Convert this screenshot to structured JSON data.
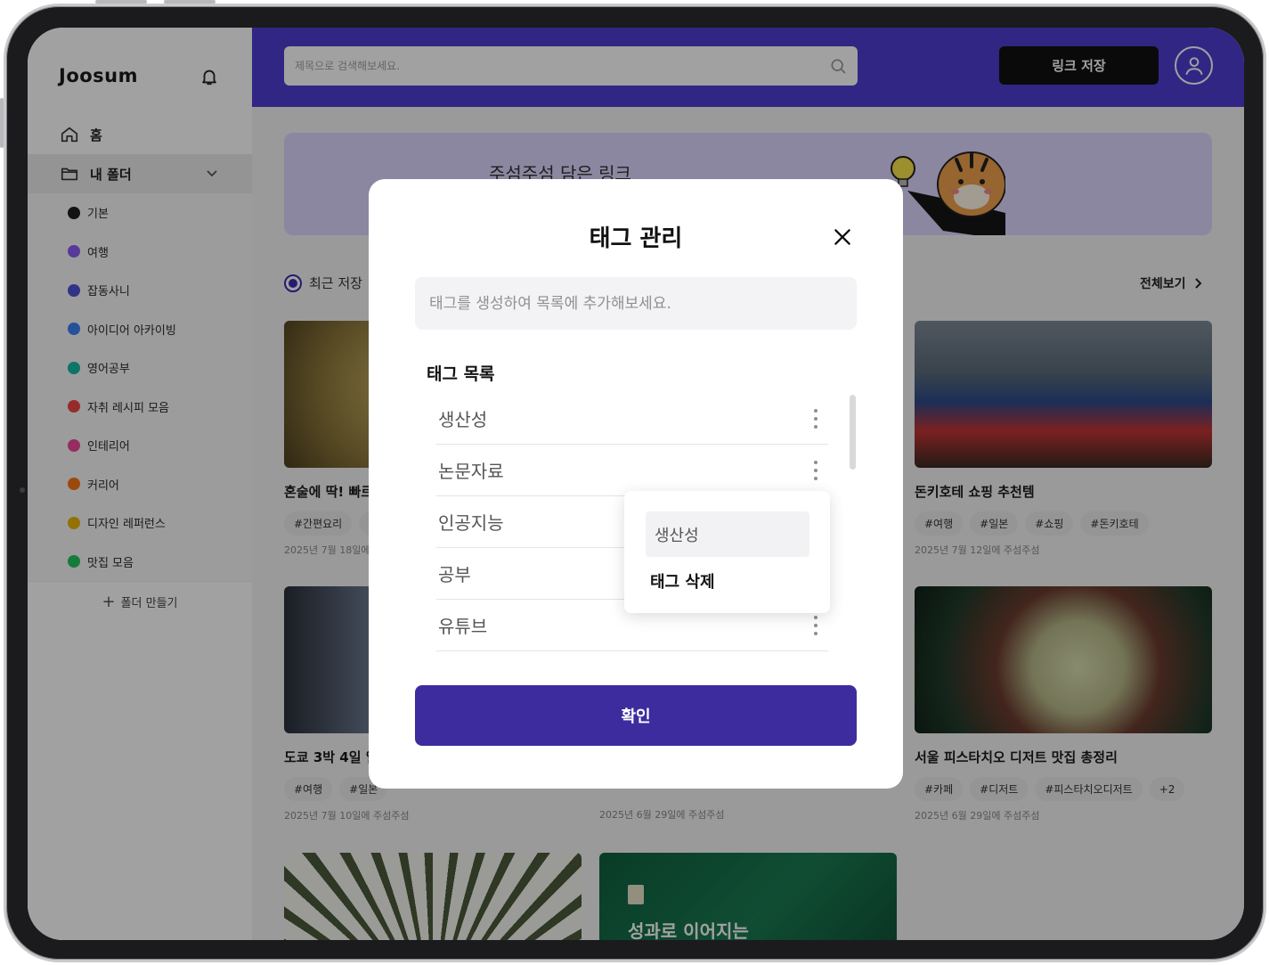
{
  "app": {
    "logo": "Joosum"
  },
  "sidebar": {
    "home": "홈",
    "my_folder": "내 폴더",
    "folders": [
      {
        "label": "기본",
        "color": "#1f1f1f"
      },
      {
        "label": "여행",
        "color": "#8b5cf6"
      },
      {
        "label": "잡동사니",
        "color": "#4f52d6"
      },
      {
        "label": "아이디어 아카이빙",
        "color": "#3b82f6"
      },
      {
        "label": "영어공부",
        "color": "#14b8a6"
      },
      {
        "label": "자취 레시피 모음",
        "color": "#ef4444"
      },
      {
        "label": "인테리어",
        "color": "#ec4899"
      },
      {
        "label": "커리어",
        "color": "#f97316"
      },
      {
        "label": "디자인 레퍼런스",
        "color": "#eab308"
      },
      {
        "label": "맛집 모음",
        "color": "#22c55e"
      }
    ],
    "add_folder": "폴더 만들기"
  },
  "topbar": {
    "search_placeholder": "제목으로 검색해보세요.",
    "save_link": "링크 저장"
  },
  "banner": {
    "text": "주섬주섬 담은 링크"
  },
  "recent": {
    "heading": "최근 저장",
    "view_all": "전체보기",
    "cards": [
      {
        "title": "혼술에 딱! 빠르",
        "tags": [
          "#간편요리",
          "#"
        ],
        "date": "2025년 7월 18일에"
      },
      {
        "title": "돈키호테 쇼핑 추천템",
        "tags": [
          "#여행",
          "#일본",
          "#쇼핑",
          "#돈키호테"
        ],
        "date": "2025년 7월 12일에 주섬주섬"
      },
      {
        "title": "도쿄 3박 4일 일",
        "tags": [
          "#여행",
          "#일본"
        ],
        "date": "2025년 7월 10일에 주섬주섬"
      },
      {
        "title": "",
        "tags": [],
        "date": "2025년 6월 29일에 주섬주섬"
      },
      {
        "title": "서울 피스타치오 디저트 맛집 총정리",
        "tags": [
          "#카페",
          "#디저트",
          "#피스타치오디저트",
          "+2"
        ],
        "date": "2025년 6월 29일에 주섬주섬"
      },
      {
        "title": "",
        "tags": [],
        "date": ""
      },
      {
        "title": "성과로 이어지는",
        "tags": [],
        "date": ""
      }
    ]
  },
  "modal": {
    "title": "태그 관리",
    "input_placeholder": "태그를 생성하여 목록에 추가해보세요.",
    "list_label": "태그 목록",
    "tags": [
      "생산성",
      "논문자료",
      "인공지능",
      "공부",
      "유튜브"
    ],
    "confirm": "확인",
    "popover": {
      "edit_value": "생산성",
      "delete_label": "태그 삭제"
    }
  }
}
